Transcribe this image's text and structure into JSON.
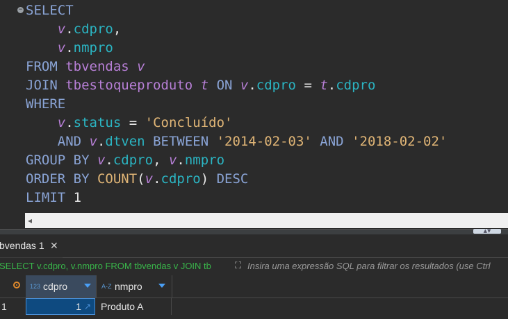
{
  "editor": {
    "lines": [
      {
        "parts": [
          {
            "t": "SELECT",
            "c": "kw"
          }
        ]
      },
      {
        "parts": [
          {
            "t": "    ",
            "c": ""
          },
          {
            "t": "v",
            "c": "al"
          },
          {
            "t": ".",
            "c": "op"
          },
          {
            "t": "cdpro",
            "c": "fld"
          },
          {
            "t": ",",
            "c": "op"
          }
        ]
      },
      {
        "parts": [
          {
            "t": "    ",
            "c": ""
          },
          {
            "t": "v",
            "c": "al"
          },
          {
            "t": ".",
            "c": "op"
          },
          {
            "t": "nmpro",
            "c": "fld"
          }
        ]
      },
      {
        "parts": [
          {
            "t": "FROM ",
            "c": "kw"
          },
          {
            "t": "tbvendas ",
            "c": "tb"
          },
          {
            "t": "v",
            "c": "al"
          }
        ]
      },
      {
        "parts": [
          {
            "t": "JOIN ",
            "c": "kw"
          },
          {
            "t": "tbestoqueproduto ",
            "c": "tb"
          },
          {
            "t": "t",
            "c": "al"
          },
          {
            "t": " ON ",
            "c": "kw"
          },
          {
            "t": "v",
            "c": "al"
          },
          {
            "t": ".",
            "c": "op"
          },
          {
            "t": "cdpro",
            "c": "fld"
          },
          {
            "t": " = ",
            "c": "op"
          },
          {
            "t": "t",
            "c": "al"
          },
          {
            "t": ".",
            "c": "op"
          },
          {
            "t": "cdpro",
            "c": "fld"
          }
        ]
      },
      {
        "parts": [
          {
            "t": "WHERE",
            "c": "kw"
          }
        ]
      },
      {
        "parts": [
          {
            "t": "    ",
            "c": ""
          },
          {
            "t": "v",
            "c": "al"
          },
          {
            "t": ".",
            "c": "op"
          },
          {
            "t": "status",
            "c": "fld"
          },
          {
            "t": " = ",
            "c": "op"
          },
          {
            "t": "'Concluído'",
            "c": "str"
          }
        ]
      },
      {
        "parts": [
          {
            "t": "    AND ",
            "c": "kw"
          },
          {
            "t": "v",
            "c": "al"
          },
          {
            "t": ".",
            "c": "op"
          },
          {
            "t": "dtven",
            "c": "fld"
          },
          {
            "t": " BETWEEN ",
            "c": "kw"
          },
          {
            "t": "'2014-02-03'",
            "c": "str"
          },
          {
            "t": " AND ",
            "c": "kw"
          },
          {
            "t": "'2018-02-02'",
            "c": "str"
          }
        ]
      },
      {
        "parts": [
          {
            "t": "GROUP BY ",
            "c": "kw"
          },
          {
            "t": "v",
            "c": "al"
          },
          {
            "t": ".",
            "c": "op"
          },
          {
            "t": "cdpro",
            "c": "fld"
          },
          {
            "t": ", ",
            "c": "op"
          },
          {
            "t": "v",
            "c": "al"
          },
          {
            "t": ".",
            "c": "op"
          },
          {
            "t": "nmpro",
            "c": "fld"
          }
        ]
      },
      {
        "parts": [
          {
            "t": "ORDER BY ",
            "c": "kw"
          },
          {
            "t": "COUNT",
            "c": "fn"
          },
          {
            "t": "(",
            "c": "op"
          },
          {
            "t": "v",
            "c": "al"
          },
          {
            "t": ".",
            "c": "op"
          },
          {
            "t": "cdpro",
            "c": "fld"
          },
          {
            "t": ") ",
            "c": "op"
          },
          {
            "t": "DESC",
            "c": "kw"
          }
        ]
      },
      {
        "parts": [
          {
            "t": "LIMIT ",
            "c": "kw"
          },
          {
            "t": "1",
            "c": "num"
          }
        ]
      }
    ],
    "fold_icon": "minus"
  },
  "hscroll": {
    "left_arrow": "◂"
  },
  "splitter": {
    "handle": "▲▼"
  },
  "results": {
    "tab_label": "bvendas 1",
    "tab_close": "✕",
    "filter_query": "SELECT v.cdpro, v.nmpro FROM tbvendas v JOIN tb",
    "filter_icon": "expand-icon",
    "filter_placeholder": "Insira uma expressão SQL para filtrar os resultados (use Ctrl",
    "columns": [
      {
        "type_badge": "123",
        "label": "cdpro"
      },
      {
        "type_badge": "A-Z",
        "label": "nmpro"
      }
    ],
    "rows": [
      {
        "num": "1",
        "cdpro": "1",
        "nmpro": "Produto A"
      }
    ]
  },
  "colors": {
    "background": "#2b2b2b",
    "keyword": "#8aa4d6",
    "alias": "#b77fd6",
    "field": "#2bb5c3",
    "string": "#e0b576",
    "filter_query": "#39b54a",
    "selected_cell": "#0e4a80"
  }
}
